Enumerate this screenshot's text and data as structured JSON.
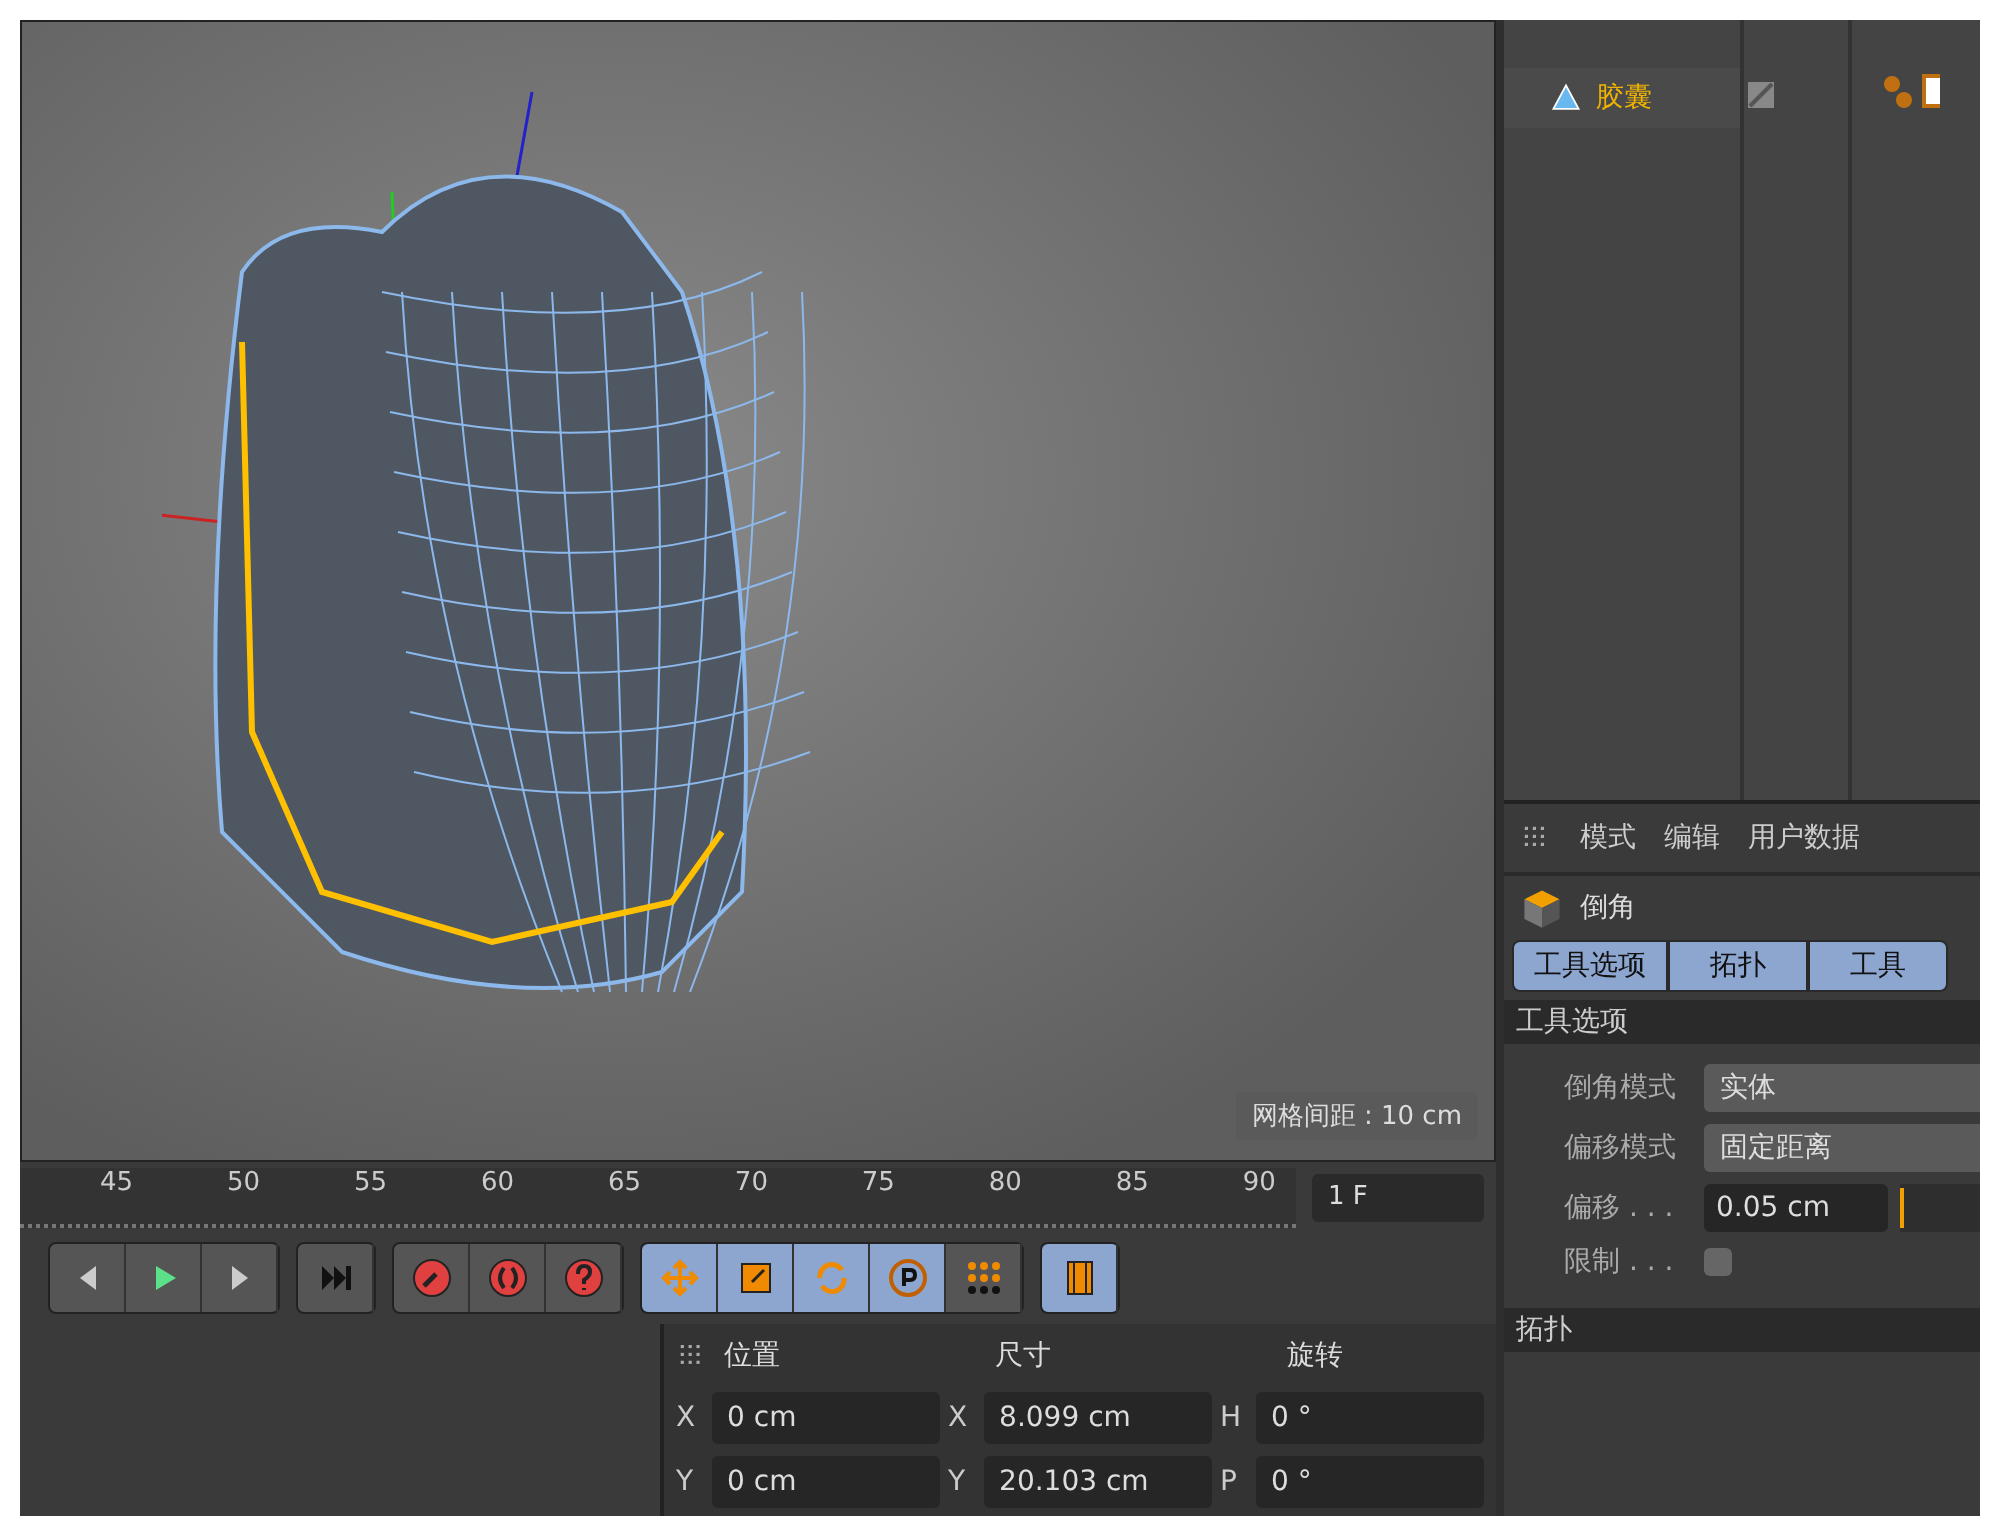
{
  "viewport": {
    "grid_label": "网格间距 : 10 cm"
  },
  "timeline": {
    "ticks": [
      "45",
      "50",
      "55",
      "60",
      "65",
      "70",
      "75",
      "80",
      "85",
      "90"
    ],
    "frame": "1 F"
  },
  "coordinates": {
    "headers": [
      "位置",
      "尺寸",
      "旋转"
    ],
    "rows": [
      [
        {
          "axis": "X",
          "value": "0 cm"
        },
        {
          "axis": "X",
          "value": "8.099 cm"
        },
        {
          "axis": "H",
          "value": "0 °"
        }
      ],
      [
        {
          "axis": "Y",
          "value": "0 cm"
        },
        {
          "axis": "Y",
          "value": "20.103 cm"
        },
        {
          "axis": "P",
          "value": "0 °"
        }
      ]
    ]
  },
  "objects": [
    {
      "name": "胶囊"
    }
  ],
  "attributes": {
    "menu": [
      "模式",
      "编辑",
      "用户数据"
    ],
    "title": "倒角",
    "tabs": [
      {
        "label": "工具选项",
        "selected": true
      },
      {
        "label": "拓扑",
        "selected": true
      },
      {
        "label": "工具",
        "selected": true
      }
    ],
    "section": "工具选项",
    "fields": [
      {
        "kind": "dropdown",
        "label": "倒角模式",
        "value": "实体"
      },
      {
        "kind": "dropdown",
        "label": "偏移模式",
        "value": "固定距离"
      },
      {
        "kind": "number",
        "label": "偏移 . . .",
        "value": "0.05 cm",
        "level": 0.01
      },
      {
        "kind": "checkbox",
        "label": "限制 . . .",
        "checked": false
      }
    ],
    "section2": "拓扑"
  }
}
